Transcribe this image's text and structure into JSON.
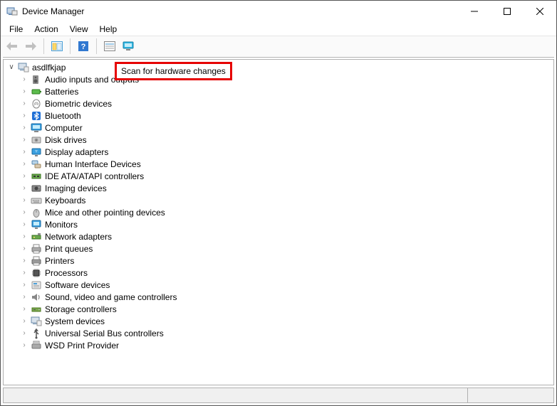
{
  "window": {
    "title": "Device Manager"
  },
  "menu": {
    "file": "File",
    "action": "Action",
    "view": "View",
    "help": "Help"
  },
  "tooltip": "Scan for hardware changes",
  "root": {
    "label": "asdlfkjap"
  },
  "categories": [
    {
      "label": "Audio inputs and outputs",
      "icon": "speaker"
    },
    {
      "label": "Batteries",
      "icon": "battery"
    },
    {
      "label": "Biometric devices",
      "icon": "biometric"
    },
    {
      "label": "Bluetooth",
      "icon": "bluetooth"
    },
    {
      "label": "Computer",
      "icon": "computer"
    },
    {
      "label": "Disk drives",
      "icon": "disk"
    },
    {
      "label": "Display adapters",
      "icon": "display"
    },
    {
      "label": "Human Interface Devices",
      "icon": "hid"
    },
    {
      "label": "IDE ATA/ATAPI controllers",
      "icon": "ide"
    },
    {
      "label": "Imaging devices",
      "icon": "imaging"
    },
    {
      "label": "Keyboards",
      "icon": "keyboard"
    },
    {
      "label": "Mice and other pointing devices",
      "icon": "mouse"
    },
    {
      "label": "Monitors",
      "icon": "monitor"
    },
    {
      "label": "Network adapters",
      "icon": "network"
    },
    {
      "label": "Print queues",
      "icon": "printqueue"
    },
    {
      "label": "Printers",
      "icon": "printer"
    },
    {
      "label": "Processors",
      "icon": "processor"
    },
    {
      "label": "Software devices",
      "icon": "software"
    },
    {
      "label": "Sound, video and game controllers",
      "icon": "sound"
    },
    {
      "label": "Storage controllers",
      "icon": "storage"
    },
    {
      "label": "System devices",
      "icon": "system"
    },
    {
      "label": "Universal Serial Bus controllers",
      "icon": "usb"
    },
    {
      "label": "WSD Print Provider",
      "icon": "wsd"
    }
  ]
}
